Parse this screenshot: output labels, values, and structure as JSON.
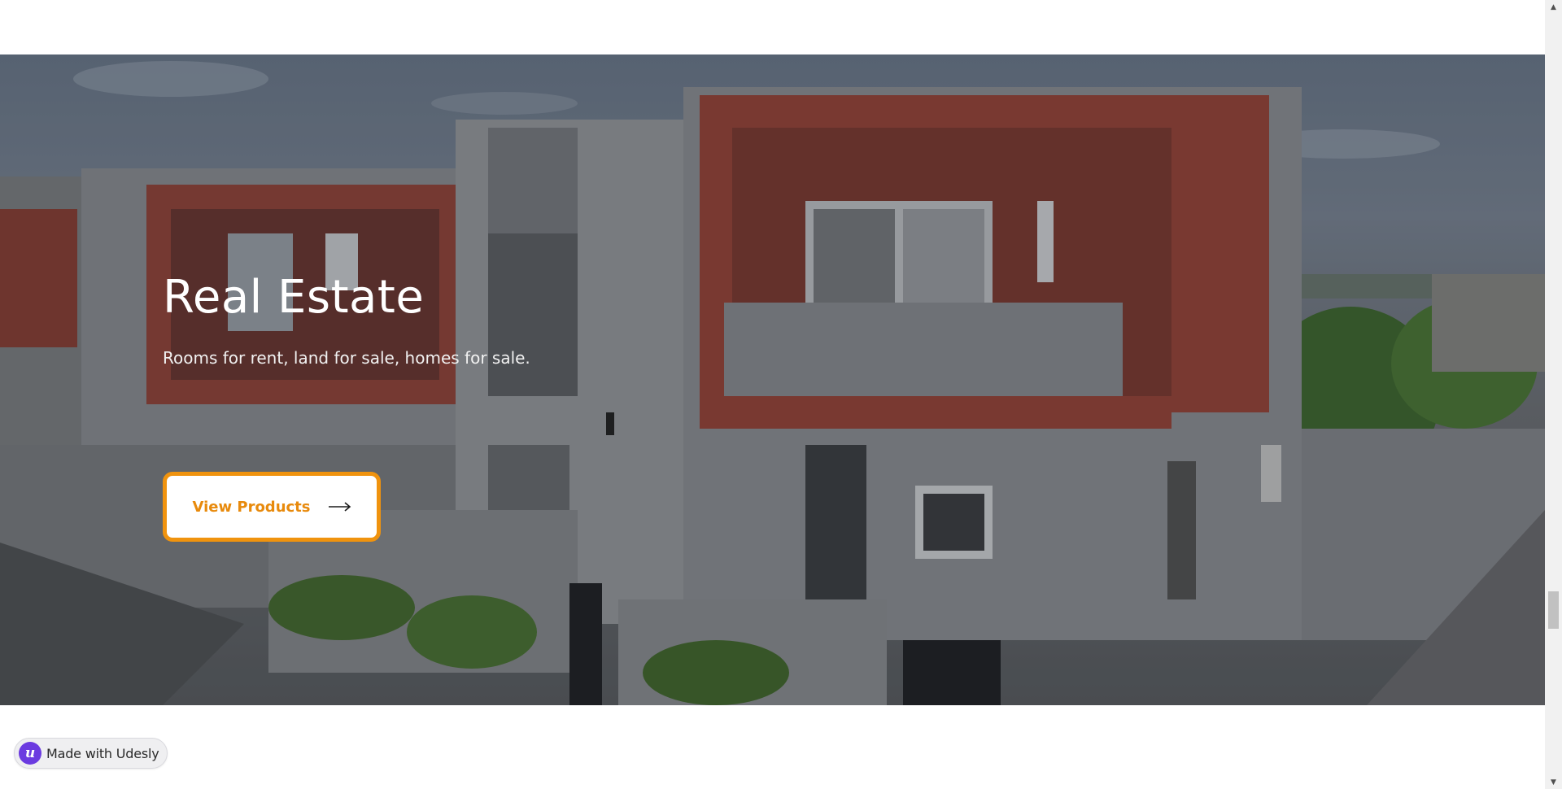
{
  "hero": {
    "title": "Real Estate",
    "subtitle": "Rooms for rent, land for sale, homes for sale.",
    "cta_label": "View Products",
    "cta_icon": "arrow-right-icon",
    "background_image": "modern two-storey houses with red-framed balconies and grey walls",
    "accent_color": "#f0930e"
  },
  "badge": {
    "logo_letter": "u",
    "label": "Made with Udesly",
    "logo_color": "#6b3be0"
  },
  "scrollbar": {
    "up_icon": "▲",
    "down_icon": "▼"
  }
}
